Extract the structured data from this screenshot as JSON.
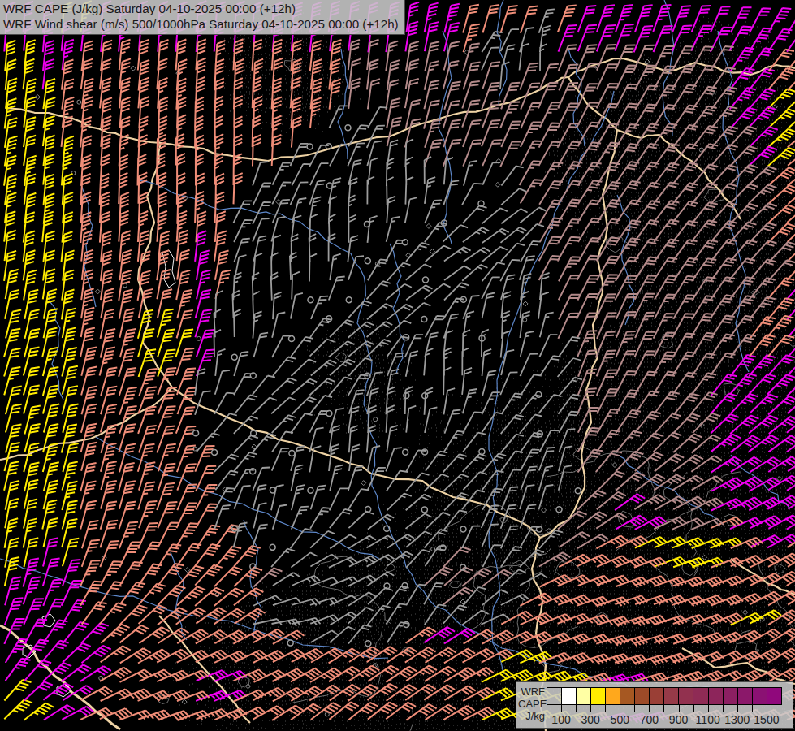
{
  "header": {
    "line1": "WRF CAPE (J/kg) Saturday 04-10-2025 00:00 (+12h)",
    "line2": "WRF Wind shear (m/s) 500/1000hPa Saturday 04-10-2025 00:00 (+12h)"
  },
  "legend": {
    "label_lines": [
      "WRF",
      "CAPE",
      "J/kg"
    ],
    "tick_labels": [
      "100",
      "300",
      "500",
      "700",
      "900",
      "1100",
      "1300",
      "1500"
    ],
    "swatch_colors": [
      "transparent",
      "#ffffff",
      "#ffffa4",
      "#ffec00",
      "#ffa81c",
      "#a65822",
      "#9d4a28",
      "#9a3f36",
      "#963a48",
      "#92314f",
      "#8f2b55",
      "#8d255b",
      "#8c1f62",
      "#8b186a",
      "#8b1173",
      "#90087c"
    ]
  },
  "map": {
    "background": "#000000",
    "border_color": "#eed2a4",
    "river_color": "#5d87c9",
    "lake_outline_color": "#f4f4f4",
    "stipple_color": "#4f4f4f",
    "contour_color": "#6e6e6e",
    "station_color": "#8f8f8f",
    "barb_colors": {
      "yellow": "#ffeb00",
      "magenta": "#ee00ee",
      "salmon": "#ef8d78",
      "rosybrown": "#b38a8a",
      "gray": "#9c9c9c"
    },
    "grid_spacing": 23.5,
    "barb_length": 34,
    "seed": 11
  }
}
